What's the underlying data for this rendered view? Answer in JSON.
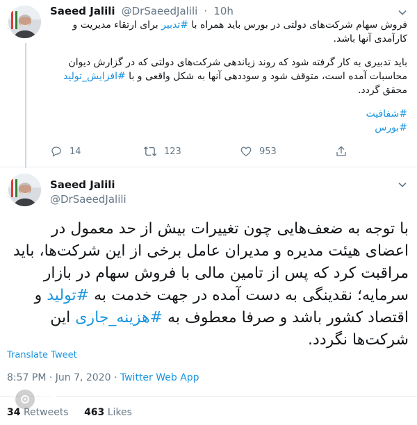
{
  "tweet1": {
    "name": "Saeed Jalili",
    "handle": "@DrSaeedJalili",
    "dot": "·",
    "time": "10h",
    "p1_a": "فروش سهام شرکت‌های دولتی در بورس  باید همراه با ",
    "p1_tag": "#تدبیر",
    "p1_b": " برای ارتقاء مدیریت و کارآمدی آنها باشد.",
    "p2_a": "باید تدبیری به کار گرفته شود که روند زیاندهی شرکت‌های دولتی که در گزارش دیوان محاسبات آمده است، متوقف شود و سوددهی آنها به شکل واقعی و با ",
    "p2_tag": "#افزایش_تولید",
    "p2_b": " محقق گردد.",
    "tags": [
      "#شفافیت",
      "#بورس"
    ],
    "replies": "14",
    "retweets": "123",
    "likes": "953"
  },
  "tweet2": {
    "name": "Saeed Jalili",
    "handle": "@DrSaeedJalili",
    "body_a": "با توجه به ضعف‌هایی چون تغییرات بیش از حد معمول در اعضای هیئت مدیره و مدیران عامل برخی از این شرکت‌ها، باید مراقبت کرد که پس از تامین مالی با فروش سهام در بازار سرمایه؛ نقدینگی به دست آمده در جهت خدمت به ",
    "tag1": "#تولید",
    "body_b": " و اقتصاد کشور باشد و صرفا معطوف به ",
    "tag2": "#هزینه_جاری",
    "body_c": " این شرکت‌ها نگردد.",
    "translate": "Translate Tweet",
    "time": "8:57 PM · Jun 7, 2020 · ",
    "source": "Twitter Web App",
    "retweets_count": "34",
    "retweets_label": "Retweets",
    "likes_count": "463",
    "likes_label": "Likes"
  },
  "watermark": "YJC",
  "colors": {
    "link": "#1b95e0",
    "muted": "#657786",
    "text": "#14171a"
  },
  "icons": [
    "avatar",
    "chevron-down-icon",
    "reply-icon",
    "retweet-icon",
    "like-icon",
    "share-icon"
  ]
}
